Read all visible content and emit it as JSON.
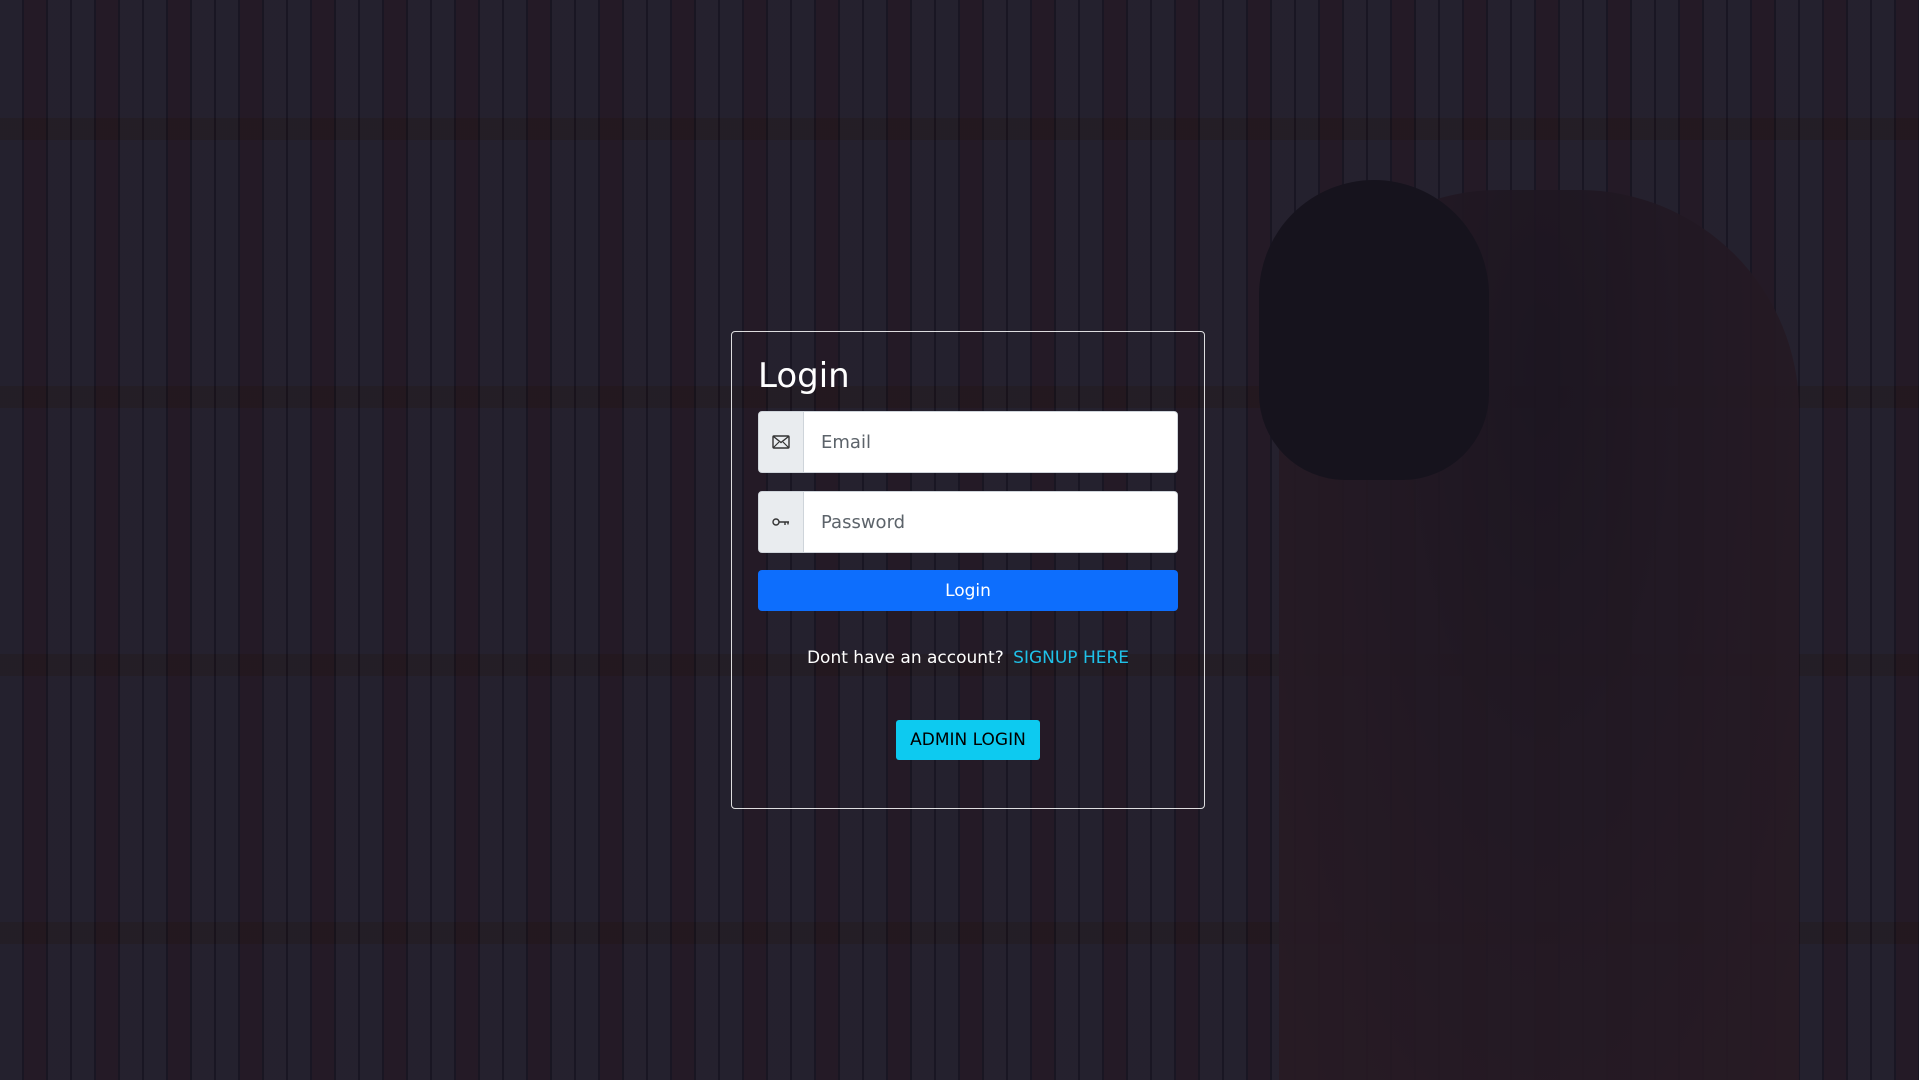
{
  "login": {
    "title": "Login",
    "email": {
      "placeholder": "Email",
      "icon": "envelope-icon"
    },
    "password": {
      "placeholder": "Password",
      "icon": "key-icon"
    },
    "submit_label": "Login",
    "signup_prompt": "Dont have an account?",
    "signup_link": "SIGNUP HERE",
    "admin_label": "ADMIN LOGIN"
  },
  "colors": {
    "primary": "#0d6efd",
    "info": "#0dcaf0",
    "link": "#1fc1e8"
  }
}
